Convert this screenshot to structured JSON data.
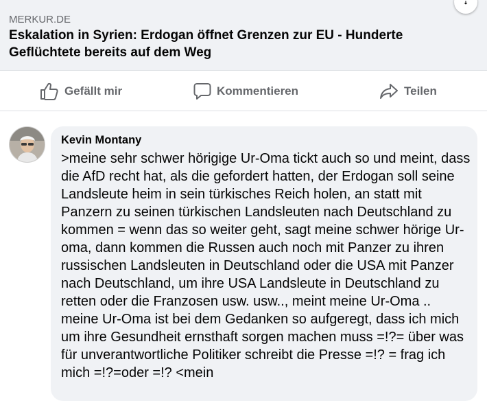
{
  "link_preview": {
    "domain": "MERKUR.DE",
    "title": "Eskalation in Syrien: Erdogan öffnet Grenzen zur EU - Hunderte Geflüchtete bereits auf dem Weg"
  },
  "corner_button": {
    "glyph": "ꜜ"
  },
  "actions": {
    "like_label": "Gefällt mir",
    "comment_label": "Kommentieren",
    "share_label": "Teilen"
  },
  "comment": {
    "author": "Kevin Montany",
    "text": ">meine sehr schwer hörigige Ur-Oma tickt auch so und meint, dass die AfD recht hat, als die gefordert hatten, der Erdogan soll seine Landsleute heim in sein türkisches Reich holen, an statt mit Panzern zu seinen türkischen Landsleuten nach Deutschland zu kommen = wenn das so weiter geht, sagt meine schwer hörige Ur-oma, dann kommen die Russen auch noch mit Panzer zu ihren russischen Landsleuten in Deutschland oder die USA mit Panzer nach Deutschland, um ihre USA Landsleute in Deutschland zu retten oder die Franzosen usw. usw.., meint meine Ur-Oma .. meine Ur-Oma ist bei dem Gedanken so aufgeregt, dass ich mich um ihre Gesundheit ernsthaft sorgen machen muss =!?= über was für unverantwortliche Politiker schreibt die Presse =!? = frag ich mich =!?=oder =!? <mein"
  },
  "colors": {
    "card_bg": "#f0f2f5",
    "action_text": "#65676b",
    "text": "#050505"
  }
}
